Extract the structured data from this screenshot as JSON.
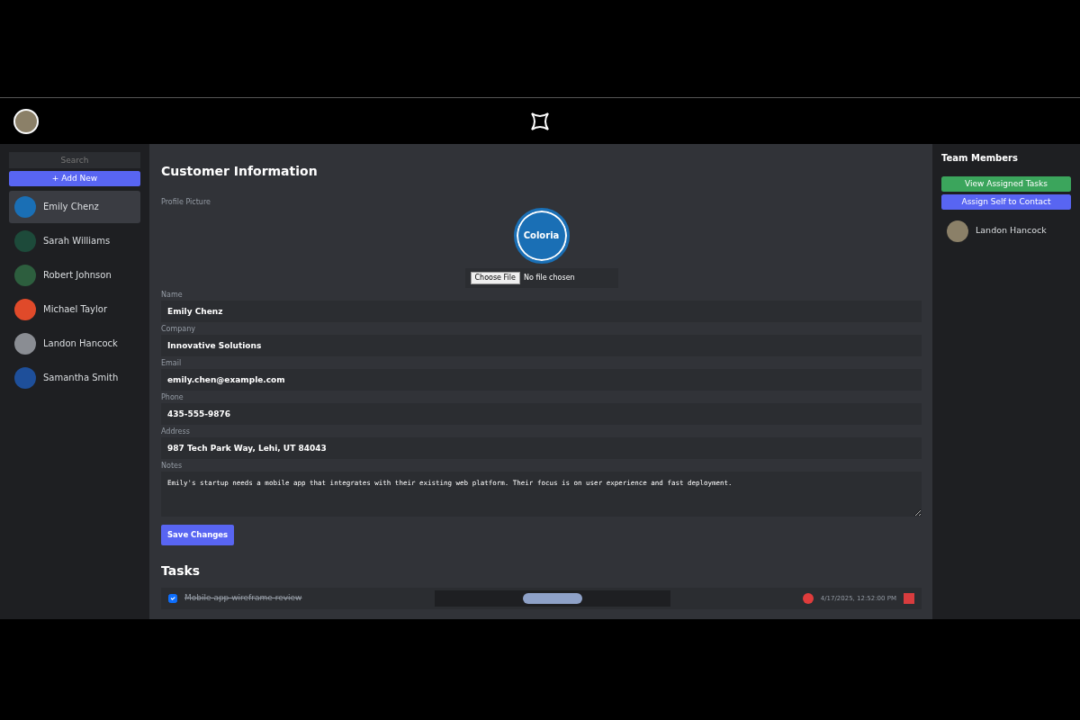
{
  "sidebar": {
    "search": {
      "placeholder": "Search"
    },
    "add_button": "+ Add New",
    "contacts": [
      {
        "name": "Emily Chenz",
        "selected": true,
        "color": "#1a6fb5"
      },
      {
        "name": "Sarah Williams",
        "selected": false,
        "color": "#1d4a3a"
      },
      {
        "name": "Robert Johnson",
        "selected": false,
        "color": "#2d5e3e"
      },
      {
        "name": "Michael Taylor",
        "selected": false,
        "color": "#e04a2a"
      },
      {
        "name": "Landon Hancock",
        "selected": false,
        "color": "#8a8d93"
      },
      {
        "name": "Samantha Smith",
        "selected": false,
        "color": "#1e4f9a"
      }
    ]
  },
  "customer": {
    "title": "Customer Information",
    "picture_label": "Profile Picture",
    "logo_text": "Coloria",
    "file_button": "Choose File",
    "file_status": "No file chosen",
    "fields": [
      {
        "label": "Name",
        "value": "Emily Chenz",
        "kind": "input"
      },
      {
        "label": "Company",
        "value": "Innovative Solutions",
        "kind": "input"
      },
      {
        "label": "Email",
        "value": "emily.chen@example.com",
        "kind": "input"
      },
      {
        "label": "Phone",
        "value": "435-555-9876",
        "kind": "input"
      },
      {
        "label": "Address",
        "value": "987 Tech Park Way, Lehi, UT 84043",
        "kind": "input"
      },
      {
        "label": "Notes",
        "value": "Emily's startup needs a mobile app that integrates with their existing web platform. Their focus is on user experience and fast deployment.",
        "kind": "textarea"
      }
    ],
    "save_button": "Save Changes"
  },
  "tasks": {
    "title": "Tasks",
    "items": [
      {
        "title": "Mobile app wireframe review",
        "done": true,
        "color": "#e03c3c",
        "date": "4/17/2025, 12:52:00 PM"
      }
    ]
  },
  "team": {
    "title": "Team Members",
    "buttons": [
      {
        "label": "View Assigned Tasks",
        "kind": "success"
      },
      {
        "label": "Assign Self to Contact",
        "kind": "primary"
      }
    ],
    "members": [
      {
        "name": "Landon Hancock"
      }
    ]
  }
}
